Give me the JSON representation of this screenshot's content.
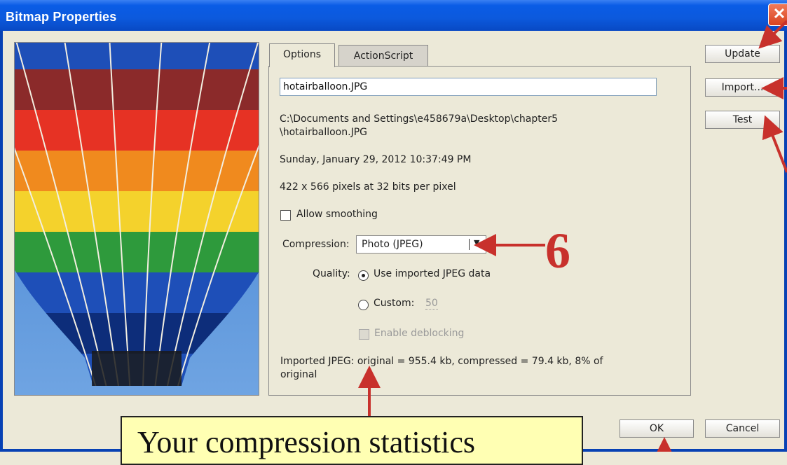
{
  "window": {
    "title": "Bitmap Properties",
    "close_label": "✕"
  },
  "tabs": [
    {
      "label": "Options",
      "active": true
    },
    {
      "label": "ActionScript",
      "active": false
    }
  ],
  "options": {
    "name_value": "hotairballoon.JPG",
    "path_line1": "C:\\Documents and Settings\\e458679a\\Desktop\\chapter5",
    "path_line2": "\\hotairballoon.JPG",
    "date": "Sunday, January 29, 2012  10:37:49 PM",
    "dimensions": "422 x 566 pixels at 32 bits per pixel",
    "allow_smoothing_label": "Allow smoothing",
    "compression_label": "Compression:",
    "compression_value": "Photo (JPEG)",
    "quality_label": "Quality:",
    "quality_imported_label": "Use imported JPEG data",
    "quality_custom_label": "Custom:",
    "quality_custom_value": "50",
    "enable_deblocking_label": "Enable deblocking",
    "stats_line1": "Imported JPEG: original = 955.4 kb, compressed = 79.4 kb, 8% of",
    "stats_line2": "original"
  },
  "buttons": {
    "update": "Update",
    "import": "Import...",
    "test": "Test",
    "ok": "OK",
    "cancel": "Cancel"
  },
  "annotations": {
    "callout_text": "Your compression statistics",
    "callout_number": "6",
    "arrow_color": "#C8312C"
  },
  "colors": {
    "titlebar": "#0A5CE6",
    "dialog_bg": "#ECE9D8",
    "callout_bg": "#FFFFB3"
  }
}
